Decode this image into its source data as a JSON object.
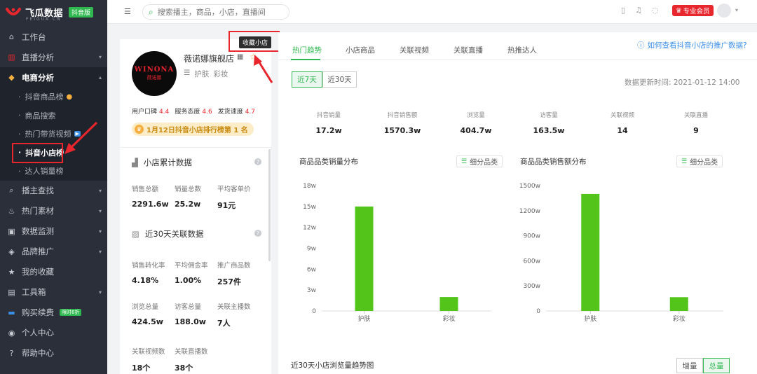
{
  "app": {
    "logo_text": "飞瓜数据",
    "logo_sub": "FEIGUA.CN",
    "logo_badge": "抖音版"
  },
  "sidebar": {
    "items": [
      {
        "label": "工作台",
        "icon": "home-icon"
      },
      {
        "label": "直播分析",
        "icon": "chart-icon"
      },
      {
        "label": "电商分析",
        "icon": "bag-icon"
      },
      {
        "label": "播主查找",
        "icon": "search-icon"
      },
      {
        "label": "热门素材",
        "icon": "fire-icon"
      },
      {
        "label": "数据监测",
        "icon": "monitor-icon"
      },
      {
        "label": "品牌推广",
        "icon": "megaphone-icon"
      },
      {
        "label": "我的收藏",
        "icon": "star-icon"
      },
      {
        "label": "工具箱",
        "icon": "toolbox-icon"
      },
      {
        "label": "购买续费",
        "icon": "card-icon",
        "tag": "限时6折"
      },
      {
        "label": "个人中心",
        "icon": "user-icon"
      },
      {
        "label": "帮助中心",
        "icon": "help-icon"
      }
    ],
    "ecommerce_sub": [
      {
        "label": "抖音商品榜"
      },
      {
        "label": "商品搜索"
      },
      {
        "label": "热门带货视频"
      },
      {
        "label": "抖音小店榜"
      },
      {
        "label": "达人销量榜"
      }
    ]
  },
  "topbar": {
    "search_placeholder": "搜索播主，商品，小店，直播间",
    "vip_label": "专业会员"
  },
  "shop": {
    "logo_line1": "WINONA",
    "logo_line2": "薇诺娜",
    "name": "薇诺娜旗舰店",
    "categories": [
      "护肤",
      "彩妆"
    ],
    "ratings": [
      {
        "label": "用户口碑",
        "value": "4.4"
      },
      {
        "label": "服务态度",
        "value": "4.6"
      },
      {
        "label": "发货速度",
        "value": "4.7"
      }
    ],
    "rank_text": "1月12日抖音小店排行榜第 1 名",
    "collect_tooltip": "收藏小店",
    "section1_title": "小店累计数据",
    "section1_stats": [
      {
        "label": "销售总额",
        "value": "2291.6w"
      },
      {
        "label": "销量总数",
        "value": "25.2w"
      },
      {
        "label": "平均客单价",
        "value": "91元"
      }
    ],
    "section2_title": "近30天关联数据",
    "section2_stats": [
      {
        "label": "销售转化率",
        "value": "4.18%"
      },
      {
        "label": "平均佣金率",
        "value": "1.00%"
      },
      {
        "label": "推广商品数",
        "value": "257件"
      },
      {
        "label": "浏览总量",
        "value": "424.5w"
      },
      {
        "label": "访客总量",
        "value": "188.0w"
      },
      {
        "label": "关联主播数",
        "value": "7人"
      },
      {
        "label": "关联视频数",
        "value": "18个"
      },
      {
        "label": "关联直播数",
        "value": "38个"
      }
    ]
  },
  "main": {
    "tabs": [
      "热门趋势",
      "小店商品",
      "关联视频",
      "关联直播",
      "热推达人"
    ],
    "help_link": "如何查看抖音小店的推广数据?",
    "range": [
      "近7天",
      "近30天"
    ],
    "update_time": "数据更新时间: 2021-01-12 14:00",
    "kpis": [
      {
        "label": "抖音销量",
        "value": "17.2w"
      },
      {
        "label": "抖音销售额",
        "value": "1570.3w"
      },
      {
        "label": "浏览量",
        "value": "404.7w"
      },
      {
        "label": "访客量",
        "value": "163.5w"
      },
      {
        "label": "关联视频",
        "value": "14"
      },
      {
        "label": "关联直播",
        "value": "9"
      }
    ],
    "fine_label": "细分品类",
    "trend_title": "近30天小店浏览量趋势图",
    "modes": [
      "增量",
      "总量"
    ]
  },
  "chart_data": [
    {
      "type": "bar",
      "title": "商品品类销量分布",
      "categories": [
        "护肤",
        "彩妆"
      ],
      "values": [
        15,
        2
      ],
      "ylim": [
        0,
        18
      ],
      "yticks": [
        0,
        3,
        6,
        9,
        12,
        15,
        18
      ],
      "ytick_labels": [
        "0",
        "3w",
        "6w",
        "9w",
        "12w",
        "15w",
        "18w"
      ],
      "color": "#52c41a"
    },
    {
      "type": "bar",
      "title": "商品品类销售额分布",
      "categories": [
        "护肤",
        "彩妆"
      ],
      "values": [
        1400,
        165
      ],
      "ylim": [
        0,
        1500
      ],
      "yticks": [
        0,
        300,
        600,
        900,
        1200,
        1500
      ],
      "ytick_labels": [
        "0",
        "300w",
        "600w",
        "900w",
        "1200w",
        "1500w"
      ],
      "color": "#52c41a"
    }
  ]
}
